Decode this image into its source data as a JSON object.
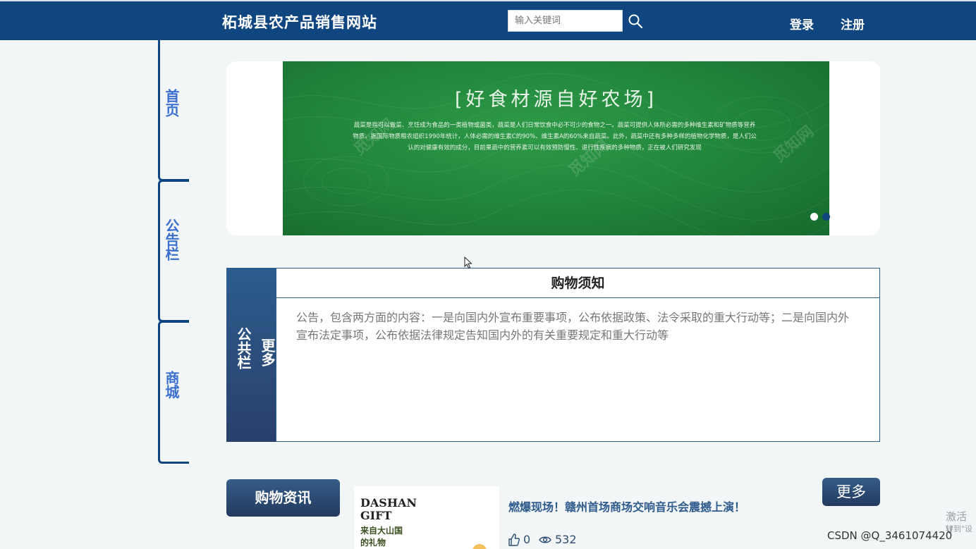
{
  "header": {
    "site_title": "柘城县农产品销售网站",
    "search_placeholder": "输入关键词",
    "search_icon": "search-icon",
    "login": "登录",
    "register": "注册"
  },
  "sidebar": {
    "items": [
      {
        "label": "首页"
      },
      {
        "label": "公告栏"
      },
      {
        "label": "商城"
      }
    ]
  },
  "banner": {
    "heading": "[好食材源自好农场]",
    "text": "蔬菜是指可以做菜、烹饪成为食品的一类植物或菌类，蔬菜是人们日常饮食中必不可少的食物之一。蔬菜可提供人体所必需的多种维生素和矿物质等营养物质。据国际物质粮农组织1990年统计，人体必需的维生素C的90%、维生素A的60%来自蔬菜。此外，蔬菜中还有多种多样的植物化学物质，是人们公认的对健康有效的成分，目前果蔬中的营养素可以有效预防慢性、退行性疾病的多种物质，正在被人们研究发现",
    "watermark": "觅知网",
    "slide_count": 2,
    "active_slide": 1
  },
  "notice": {
    "tab_title": "公共栏",
    "tab_more": "更多",
    "title": "购物须知",
    "body": "公告，包含两方面的内容：一是向国内外宣布重要事项，公布依据政策、法令采取的重大行动等；二是向国内外宣布法定事项，公布依据法律规定告知国内外的有关重要规定和重大行动等"
  },
  "news": {
    "tab_label": "购物资讯",
    "more_label": "更多",
    "items": [
      {
        "thumb_lines": [
          "DASHAN",
          "GIFT",
          "来自大山国",
          "的礼物"
        ],
        "title": "燃爆现场！赣州首场商场交响音乐会震撼上演！",
        "likes": "0",
        "views": "532"
      }
    ]
  },
  "overlay": {
    "csdn": "CSDN @Q_3461074420",
    "activate_1": "激活 V",
    "activate_2": "转到\"设"
  },
  "colors": {
    "header_bg": "#0f4680",
    "nav_text": "#3a6fd0",
    "banner_green": "#22873c",
    "accent_dark": "#233a5e"
  }
}
